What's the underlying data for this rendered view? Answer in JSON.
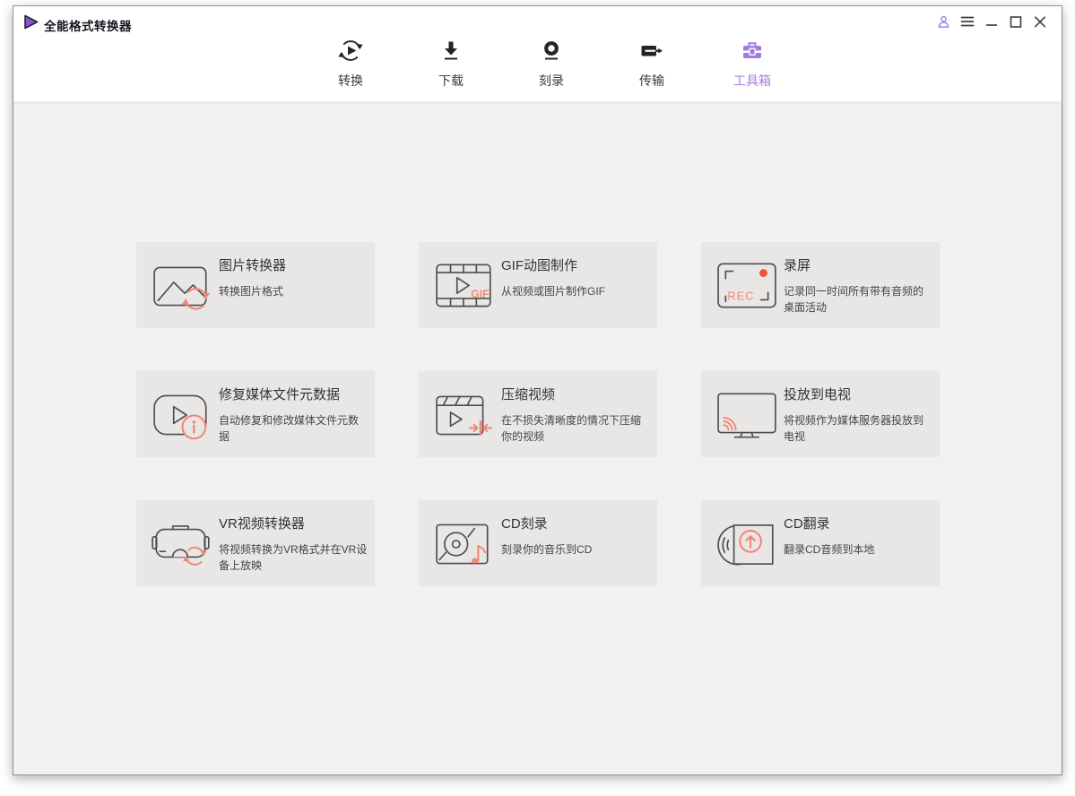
{
  "window": {
    "title": "全能格式转换器",
    "controls": [
      {
        "name": "account-button",
        "icon": "person-icon"
      },
      {
        "name": "menu-button",
        "icon": "hamburger-icon"
      },
      {
        "name": "minimize-button",
        "icon": "minimize-icon"
      },
      {
        "name": "maximize-button",
        "icon": "maximize-icon"
      },
      {
        "name": "close-button",
        "icon": "close-icon"
      }
    ]
  },
  "nav": {
    "tabs": [
      {
        "label": "转换",
        "icon": "convert-icon",
        "active": false
      },
      {
        "label": "下载",
        "icon": "download-icon",
        "active": false
      },
      {
        "label": "刻录",
        "icon": "burn-icon",
        "active": false
      },
      {
        "label": "传输",
        "icon": "transfer-icon",
        "active": false
      },
      {
        "label": "工具箱",
        "icon": "toolbox-icon",
        "active": true
      }
    ]
  },
  "cards": [
    {
      "title": "图片转换器",
      "description": "转换图片格式",
      "icon": "image-converter-icon"
    },
    {
      "title": "GIF动图制作",
      "description": "从视频或图片制作GIF",
      "icon": "gif-maker-icon",
      "icon_text": "GIF"
    },
    {
      "title": "录屏",
      "description": "记录同一时间所有带有音频的桌面活动",
      "icon": "screen-record-icon",
      "icon_text": "REC"
    },
    {
      "title": "修复媒体文件元数据",
      "description": "自动修复和修改媒体文件元数据",
      "icon": "fix-metadata-icon"
    },
    {
      "title": "压缩视频",
      "description": "在不损失清晰度的情况下压缩你的视频",
      "icon": "compress-video-icon"
    },
    {
      "title": "投放到电视",
      "description": "将视频作为媒体服务器投放到电视",
      "icon": "cast-tv-icon"
    },
    {
      "title": "VR视频转换器",
      "description": "将视频转换为VR格式并在VR设备上放映",
      "icon": "vr-converter-icon"
    },
    {
      "title": "CD刻录",
      "description": "刻录你的音乐到CD",
      "icon": "cd-burn-icon"
    },
    {
      "title": "CD翻录",
      "description": "翻录CD音频到本地",
      "icon": "cd-rip-icon"
    }
  ],
  "colors": {
    "accent_purple": "#a47ce0",
    "underline_purple": "#9f6ede",
    "accent_coral": "#f28577",
    "record_red": "#f4513b",
    "icon_dark": "#2e2e2e",
    "card_bg": "#e8e7e5",
    "main_bg": "#f2f1f0"
  }
}
